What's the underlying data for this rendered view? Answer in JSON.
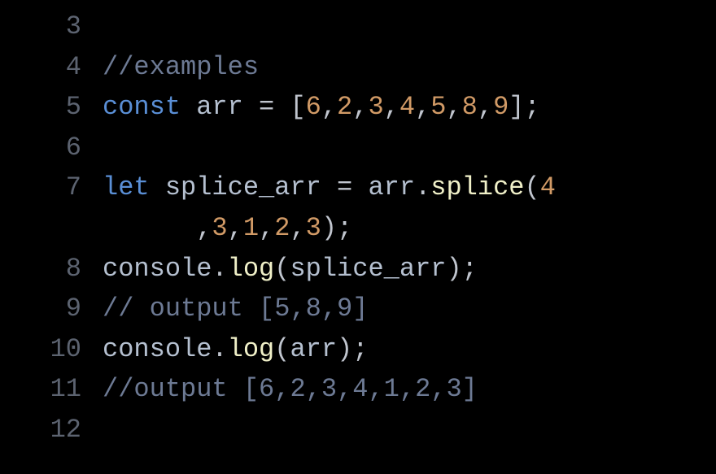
{
  "lines": [
    {
      "n": "3",
      "tokens": []
    },
    {
      "n": "4",
      "tokens": [
        {
          "c": "tok-comment",
          "t": "//examples"
        }
      ]
    },
    {
      "n": "5",
      "tokens": [
        {
          "c": "tok-keyword",
          "t": "const"
        },
        {
          "c": "tok-ident",
          "t": " arr "
        },
        {
          "c": "tok-op",
          "t": "="
        },
        {
          "c": "tok-punct",
          "t": " ["
        },
        {
          "c": "tok-num",
          "t": "6"
        },
        {
          "c": "tok-punct",
          "t": ","
        },
        {
          "c": "tok-num",
          "t": "2"
        },
        {
          "c": "tok-punct",
          "t": ","
        },
        {
          "c": "tok-num",
          "t": "3"
        },
        {
          "c": "tok-punct",
          "t": ","
        },
        {
          "c": "tok-num",
          "t": "4"
        },
        {
          "c": "tok-punct",
          "t": ","
        },
        {
          "c": "tok-num",
          "t": "5"
        },
        {
          "c": "tok-punct",
          "t": ","
        },
        {
          "c": "tok-num",
          "t": "8"
        },
        {
          "c": "tok-punct",
          "t": ","
        },
        {
          "c": "tok-num",
          "t": "9"
        },
        {
          "c": "tok-punct",
          "t": "];"
        }
      ]
    },
    {
      "n": "6",
      "tokens": []
    },
    {
      "n": "7",
      "tokens": [
        {
          "c": "tok-keyword",
          "t": "let"
        },
        {
          "c": "tok-ident",
          "t": " splice_arr "
        },
        {
          "c": "tok-op",
          "t": "="
        },
        {
          "c": "tok-ident",
          "t": " arr"
        },
        {
          "c": "tok-punct",
          "t": "."
        },
        {
          "c": "tok-method",
          "t": "splice"
        },
        {
          "c": "tok-punct",
          "t": "("
        },
        {
          "c": "tok-num",
          "t": "4"
        }
      ]
    },
    {
      "n": "",
      "wrap": true,
      "tokens": [
        {
          "c": "tok-punct",
          "t": ","
        },
        {
          "c": "tok-num",
          "t": "3"
        },
        {
          "c": "tok-punct",
          "t": ","
        },
        {
          "c": "tok-num",
          "t": "1"
        },
        {
          "c": "tok-punct",
          "t": ","
        },
        {
          "c": "tok-num",
          "t": "2"
        },
        {
          "c": "tok-punct",
          "t": ","
        },
        {
          "c": "tok-num",
          "t": "3"
        },
        {
          "c": "tok-punct",
          "t": ");"
        }
      ]
    },
    {
      "n": "8",
      "tokens": [
        {
          "c": "tok-object",
          "t": "console"
        },
        {
          "c": "tok-punct",
          "t": "."
        },
        {
          "c": "tok-method",
          "t": "log"
        },
        {
          "c": "tok-punct",
          "t": "("
        },
        {
          "c": "tok-ident",
          "t": "splice_arr"
        },
        {
          "c": "tok-punct",
          "t": ");"
        }
      ]
    },
    {
      "n": "9",
      "tokens": [
        {
          "c": "tok-comment",
          "t": "// output [5,8,9]"
        }
      ]
    },
    {
      "n": "10",
      "tokens": [
        {
          "c": "tok-object",
          "t": "console"
        },
        {
          "c": "tok-punct",
          "t": "."
        },
        {
          "c": "tok-method",
          "t": "log"
        },
        {
          "c": "tok-punct",
          "t": "("
        },
        {
          "c": "tok-ident",
          "t": "arr"
        },
        {
          "c": "tok-punct",
          "t": ");"
        }
      ]
    },
    {
      "n": "11",
      "tokens": [
        {
          "c": "tok-comment",
          "t": "//output [6,2,3,4,1,2,3]"
        }
      ]
    },
    {
      "n": "12",
      "tokens": []
    }
  ]
}
